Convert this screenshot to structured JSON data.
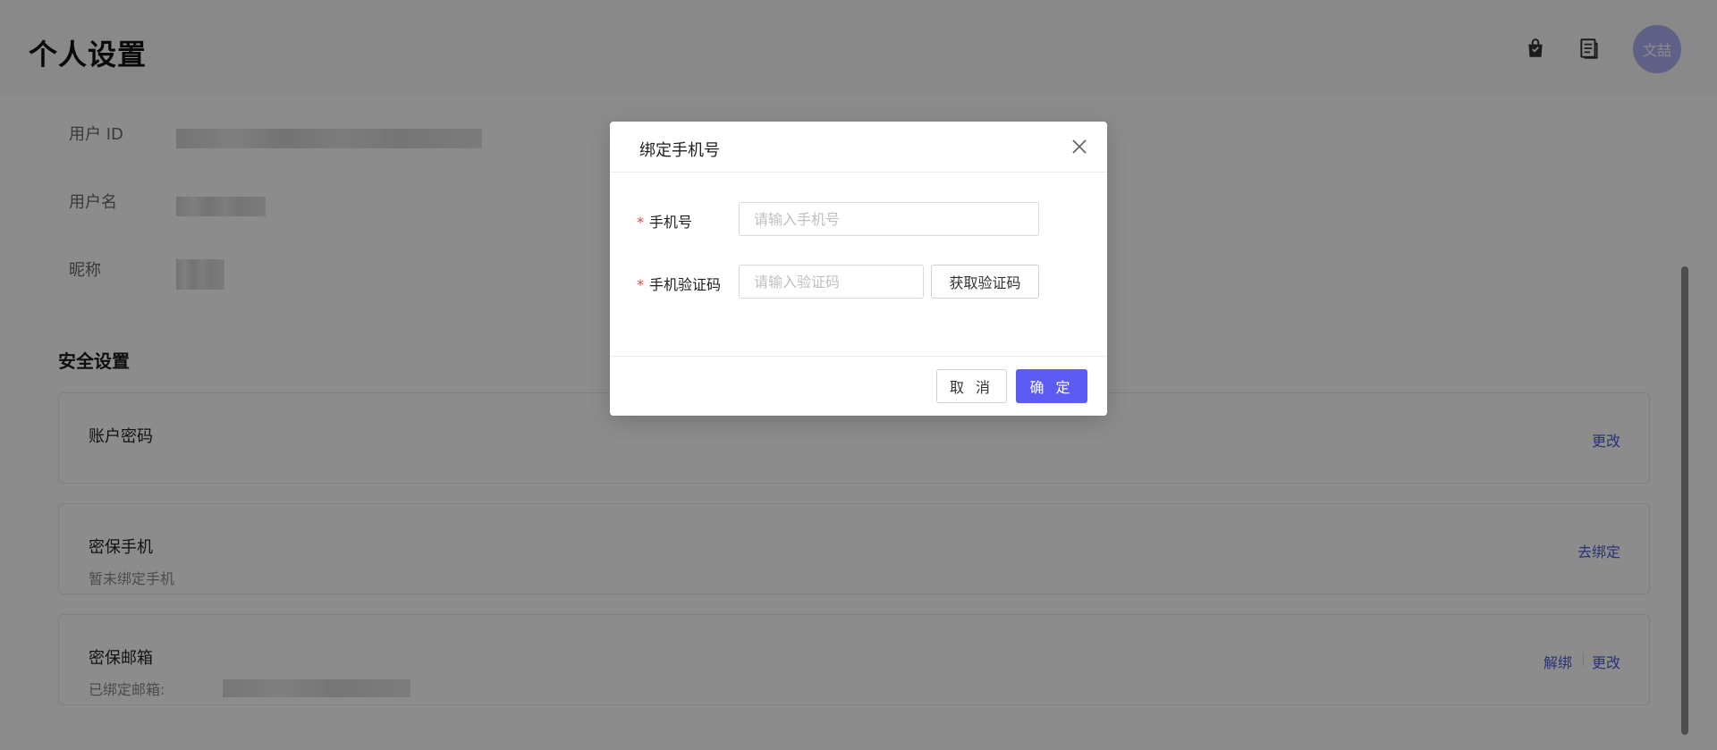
{
  "header": {
    "title": "个人设置",
    "avatar_text": "文喆",
    "icons": [
      "shopping-bag-icon",
      "document-icon"
    ]
  },
  "profile": {
    "rows": [
      {
        "label": "用户 ID"
      },
      {
        "label": "用户名"
      },
      {
        "label": "昵称"
      }
    ]
  },
  "security": {
    "title": "安全设置",
    "cards": [
      {
        "title": "账户密码",
        "subtitle": "",
        "actions": [
          "更改"
        ]
      },
      {
        "title": "密保手机",
        "subtitle": "暂未绑定手机",
        "actions": [
          "去绑定"
        ]
      },
      {
        "title": "密保邮箱",
        "subtitle": "已绑定邮箱:",
        "actions": [
          "解绑",
          "更改"
        ]
      }
    ]
  },
  "dialog": {
    "title": "绑定手机号",
    "phone": {
      "label": "手机号",
      "placeholder": "请输入手机号",
      "value": ""
    },
    "code": {
      "label": "手机验证码",
      "placeholder": "请输入验证码",
      "value": "",
      "button": "获取验证码"
    },
    "cancel": "取 消",
    "confirm": "确 定"
  },
  "colors": {
    "primary": "#5c5cf5",
    "link": "#4b5bd8",
    "required": "#e8453c",
    "avatar_bg": "#aeb0f4",
    "overlay": "rgba(0,0,0,0.45)"
  }
}
